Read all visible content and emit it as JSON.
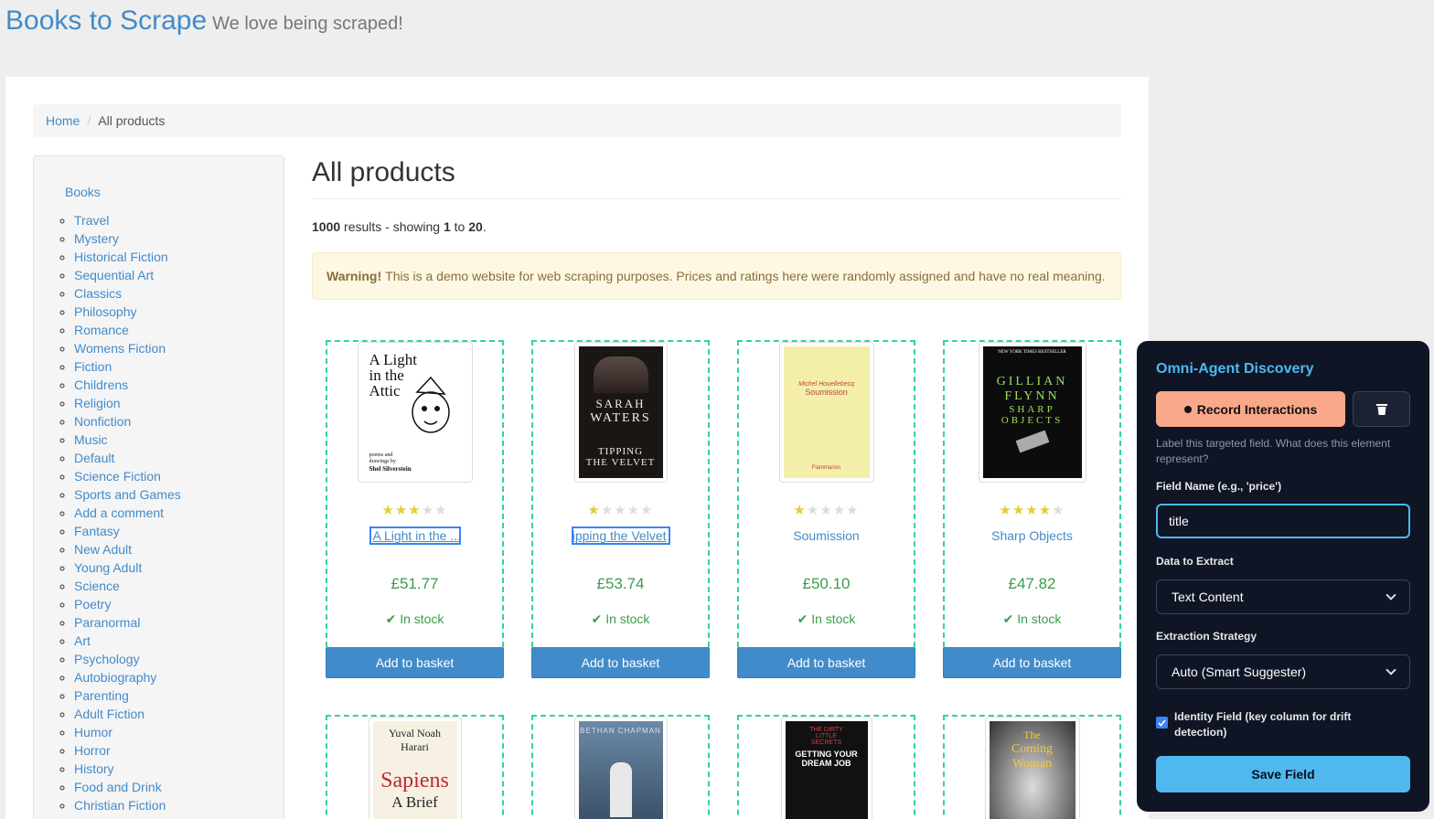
{
  "header": {
    "brand": "Books to Scrape",
    "tagline": "We love being scraped!"
  },
  "breadcrumb": {
    "home": "Home",
    "sep": "/",
    "current": "All products"
  },
  "sidebar": {
    "root": "Books",
    "categories": [
      "Travel",
      "Mystery",
      "Historical Fiction",
      "Sequential Art",
      "Classics",
      "Philosophy",
      "Romance",
      "Womens Fiction",
      "Fiction",
      "Childrens",
      "Religion",
      "Nonfiction",
      "Music",
      "Default",
      "Science Fiction",
      "Sports and Games",
      "Add a comment",
      "Fantasy",
      "New Adult",
      "Young Adult",
      "Science",
      "Poetry",
      "Paranormal",
      "Art",
      "Psychology",
      "Autobiography",
      "Parenting",
      "Adult Fiction",
      "Humor",
      "Horror",
      "History",
      "Food and Drink",
      "Christian Fiction"
    ]
  },
  "main": {
    "title": "All products",
    "results": {
      "total": "1000",
      "text1": " results - showing ",
      "from": "1",
      "text2": " to ",
      "to": "20",
      "end": "."
    },
    "warning": {
      "bold": "Warning!",
      "text": "This is a demo website for web scraping purposes. Prices and ratings here were randomly assigned and have no real meaning."
    },
    "basket_label": "Add to basket",
    "stock_label": "In stock",
    "products": [
      {
        "title": "A Light in the ...",
        "price": "£51.77",
        "rating": 3
      },
      {
        "title": "Tipping the Velvet",
        "price": "£53.74",
        "rating": 1
      },
      {
        "title": "Soumission",
        "price": "£50.10",
        "rating": 1
      },
      {
        "title": "Sharp Objects",
        "price": "£47.82",
        "rating": 4
      }
    ],
    "covers": {
      "c1": {
        "l1": "A Light",
        "l2": "in the",
        "l3": "Attic",
        "l4": "poems and",
        "l5": "drawings by",
        "l6": "Shel Silverstein"
      },
      "c2": {
        "l1": "SARAH",
        "l2": "WATERS",
        "l3": "TIPPING",
        "l4": "THE VELVET"
      },
      "c3": {
        "l1": "Michel Houellebecq",
        "l2": "Soumission",
        "l3": "Flammarion"
      },
      "c4": {
        "l1": "NEW YORK TIMES BESTSELLER",
        "l2": "GILLIAN",
        "l3": "FLYNN",
        "l4": "SHARP",
        "l5": "OBJECTS"
      },
      "c5": {
        "l1": "Yuval Noah",
        "l2": "Harari",
        "l3": "Sapiens",
        "l4": "A Brief"
      },
      "c6": {
        "l1": "BETHAN CHAPMAN"
      },
      "c7": {
        "l1": "THE DIRTY",
        "l2": "LITTLE",
        "l3": "SECRETS",
        "l4": "GETTING YOUR",
        "l5": "DREAM JOB"
      },
      "c8": {
        "l1": "The",
        "l2": "Coming",
        "l3": "Woman"
      }
    }
  },
  "omni": {
    "title": "Omni-Agent Discovery",
    "record_label": "Record Interactions",
    "hint": "Label this targeted field. What does this element represent?",
    "field_name_label": "Field Name (e.g., 'price')",
    "field_name_value": "title",
    "data_label": "Data to Extract",
    "data_value": "Text Content",
    "strategy_label": "Extraction Strategy",
    "strategy_value": "Auto (Smart Suggester)",
    "identity_label": "Identity Field (key column for drift detection)",
    "save_label": "Save Field"
  },
  "colors": {
    "link": "#428bca",
    "price": "#3c9c4c",
    "star": "#e6ce31",
    "panel_bg": "#0f1524",
    "accent": "#4fb8ef",
    "record": "#f9a88a",
    "highlight": "#34d399"
  }
}
